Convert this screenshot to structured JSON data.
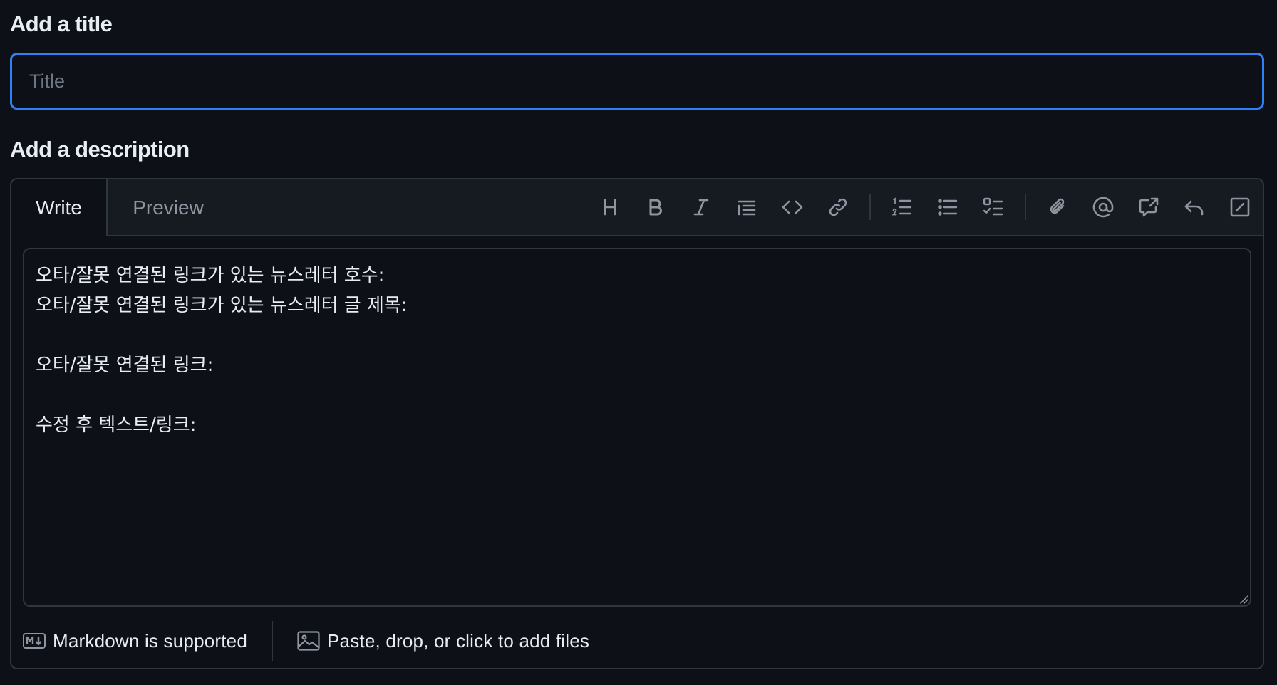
{
  "title_section": {
    "label": "Add a title",
    "input_placeholder": "Title",
    "input_value": ""
  },
  "description_section": {
    "label": "Add a description",
    "tabs": [
      {
        "label": "Write",
        "active": true
      },
      {
        "label": "Preview",
        "active": false
      }
    ],
    "toolbar": [
      "heading-icon",
      "bold-icon",
      "italic-icon",
      "quote-icon",
      "code-icon",
      "link-icon",
      "ordered-list-icon",
      "unordered-list-icon",
      "task-list-icon",
      "attachment-icon",
      "mention-icon",
      "cross-reference-icon",
      "saved-reply-icon",
      "fullscreen-icon"
    ],
    "body_value": "오타/잘못 연결된 링크가 있는 뉴스레터 호수:\n오타/잘못 연결된 링크가 있는 뉴스레터 글 제목:\n\n오타/잘못 연결된 링크:\n\n수정 후 텍스트/링크:",
    "footer": {
      "markdown_label": "Markdown is supported",
      "files_label": "Paste, drop, or click to add files"
    }
  },
  "colors": {
    "background": "#0d1117",
    "panel": "#161b22",
    "border": "#30363d",
    "accent": "#2f81f7",
    "text": "#e6edf3",
    "muted": "#8d96a0"
  }
}
